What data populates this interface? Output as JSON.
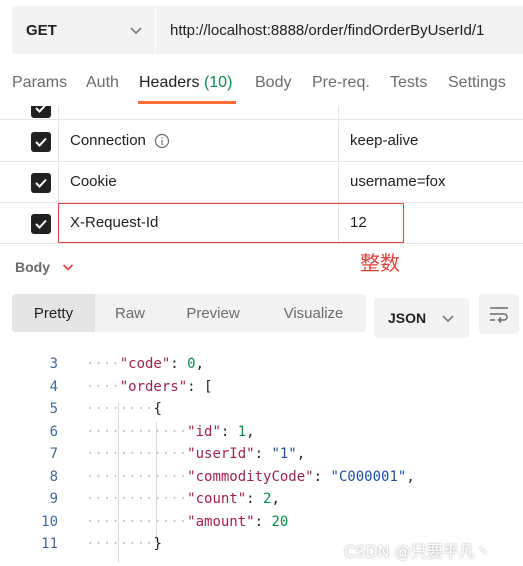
{
  "request": {
    "method": "GET",
    "url": "http://localhost:8888/order/findOrderByUserId/1"
  },
  "tabs": [
    {
      "label": "Params"
    },
    {
      "label": "Auth"
    },
    {
      "label": "Headers",
      "count": "(10)"
    },
    {
      "label": "Body"
    },
    {
      "label": "Pre-req."
    },
    {
      "label": "Tests"
    },
    {
      "label": "Settings"
    }
  ],
  "headers": [
    {
      "key": "Connection",
      "value": "keep-alive",
      "checked": true,
      "info": true
    },
    {
      "key": "Cookie",
      "value": "username=fox",
      "checked": true
    },
    {
      "key": "X-Request-Id",
      "value": "12",
      "checked": true
    }
  ],
  "annotation": "整数",
  "response": {
    "section_label": "Body",
    "view_tabs": [
      "Pretty",
      "Raw",
      "Preview",
      "Visualize"
    ],
    "active_view": "Pretty",
    "format": "JSON",
    "lines": [
      {
        "n": "3",
        "dots": "····",
        "tokens": [
          {
            "t": "\"code\"",
            "c": "key"
          },
          {
            "t": ": ",
            "c": ""
          },
          {
            "t": "0",
            "c": "num"
          },
          {
            "t": ",",
            "c": ""
          }
        ]
      },
      {
        "n": "4",
        "dots": "····",
        "tokens": [
          {
            "t": "\"orders\"",
            "c": "key"
          },
          {
            "t": ": [",
            "c": ""
          }
        ]
      },
      {
        "n": "5",
        "dots": "········",
        "tokens": [
          {
            "t": "{",
            "c": ""
          }
        ]
      },
      {
        "n": "6",
        "dots": "············",
        "tokens": [
          {
            "t": "\"id\"",
            "c": "key"
          },
          {
            "t": ": ",
            "c": ""
          },
          {
            "t": "1",
            "c": "num"
          },
          {
            "t": ",",
            "c": ""
          }
        ]
      },
      {
        "n": "7",
        "dots": "············",
        "tokens": [
          {
            "t": "\"userId\"",
            "c": "key"
          },
          {
            "t": ": ",
            "c": ""
          },
          {
            "t": "\"1\"",
            "c": "str"
          },
          {
            "t": ",",
            "c": ""
          }
        ]
      },
      {
        "n": "8",
        "dots": "············",
        "tokens": [
          {
            "t": "\"commodityCode\"",
            "c": "key"
          },
          {
            "t": ": ",
            "c": ""
          },
          {
            "t": "\"C000001\"",
            "c": "str"
          },
          {
            "t": ",",
            "c": ""
          }
        ]
      },
      {
        "n": "9",
        "dots": "············",
        "tokens": [
          {
            "t": "\"count\"",
            "c": "key"
          },
          {
            "t": ": ",
            "c": ""
          },
          {
            "t": "2",
            "c": "num"
          },
          {
            "t": ",",
            "c": ""
          }
        ]
      },
      {
        "n": "10",
        "dots": "············",
        "tokens": [
          {
            "t": "\"amount\"",
            "c": "key"
          },
          {
            "t": ": ",
            "c": ""
          },
          {
            "t": "20",
            "c": "num"
          }
        ]
      },
      {
        "n": "11",
        "dots": "········",
        "tokens": [
          {
            "t": "}",
            "c": ""
          }
        ]
      }
    ]
  },
  "watermark": "CSDN @只要平凡丶",
  "colors": {
    "accent": "#ff6c37",
    "count": "#0c8a4e",
    "annotation": "#e0413a"
  }
}
